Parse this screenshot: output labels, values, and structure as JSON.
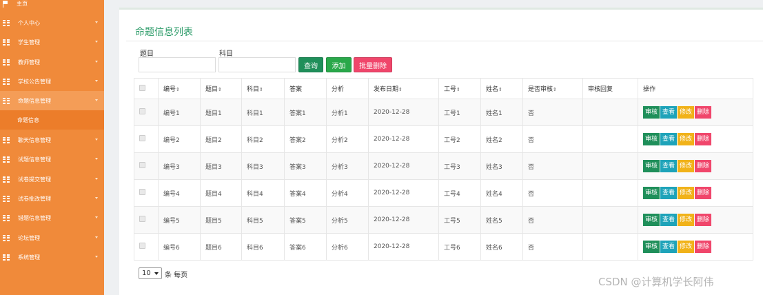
{
  "sidebar": {
    "items": [
      {
        "label": "主页",
        "icon": "flag-icon"
      },
      {
        "label": "个人中心",
        "icon": "grid-icon"
      },
      {
        "label": "学生管理",
        "icon": "grid-icon"
      },
      {
        "label": "教师管理",
        "icon": "grid-icon"
      },
      {
        "label": "学校公告管理",
        "icon": "grid-icon"
      },
      {
        "label": "命题信息管理",
        "icon": "grid-icon"
      },
      {
        "label": "聊天信息管理",
        "icon": "grid-icon"
      },
      {
        "label": "试题信息管理",
        "icon": "grid-icon"
      },
      {
        "label": "试卷提交管理",
        "icon": "grid-icon"
      },
      {
        "label": "试卷批改管理",
        "icon": "grid-icon"
      },
      {
        "label": "错题信息管理",
        "icon": "grid-icon"
      },
      {
        "label": "论坛管理",
        "icon": "grid-icon"
      },
      {
        "label": "系统管理",
        "icon": "grid-icon"
      }
    ],
    "sub_item": "命题信息",
    "color": "#f08a3a"
  },
  "main": {
    "title": "命题信息列表",
    "search": {
      "topic_label": "题目",
      "subject_label": "科目",
      "topic_value": "",
      "subject_value": ""
    },
    "buttons": {
      "query": "查询",
      "add": "添加",
      "batch_delete": "批量删除"
    },
    "table": {
      "headers": [
        "编号",
        "题目",
        "科目",
        "答案",
        "分析",
        "发布日期",
        "工号",
        "姓名",
        "是否审核",
        "审核回复",
        "操作"
      ],
      "sortable": [
        true,
        true,
        true,
        false,
        false,
        true,
        true,
        true,
        true,
        false,
        false
      ],
      "rows": [
        [
          "编号1",
          "题目1",
          "科目1",
          "答案1",
          "分析1",
          "2020-12-28",
          "工号1",
          "姓名1",
          "否",
          ""
        ],
        [
          "编号2",
          "题目2",
          "科目2",
          "答案2",
          "分析2",
          "2020-12-28",
          "工号2",
          "姓名2",
          "否",
          ""
        ],
        [
          "编号3",
          "题目3",
          "科目3",
          "答案3",
          "分析3",
          "2020-12-28",
          "工号3",
          "姓名3",
          "否",
          ""
        ],
        [
          "编号4",
          "题目4",
          "科目4",
          "答案4",
          "分析4",
          "2020-12-28",
          "工号4",
          "姓名4",
          "否",
          ""
        ],
        [
          "编号5",
          "题目5",
          "科目5",
          "答案5",
          "分析5",
          "2020-12-28",
          "工号5",
          "姓名5",
          "否",
          ""
        ],
        [
          "编号6",
          "题目6",
          "科目6",
          "答案6",
          "分析6",
          "2020-12-28",
          "工号6",
          "姓名6",
          "否",
          ""
        ]
      ],
      "actions": {
        "review": "审核",
        "view": "查看",
        "edit": "修改",
        "delete": "删除"
      }
    },
    "pager": {
      "page_size": "10",
      "suffix": "条 每页"
    }
  },
  "watermark": "CSDN @计算机学长阿伟",
  "colors": {
    "title": "#2e9c6a",
    "query_btn": "#1f8f5a",
    "add_btn": "#29a84a",
    "delete_btn": "#f0466b",
    "view_btn": "#1ea3b9",
    "edit_btn": "#f1b219"
  }
}
